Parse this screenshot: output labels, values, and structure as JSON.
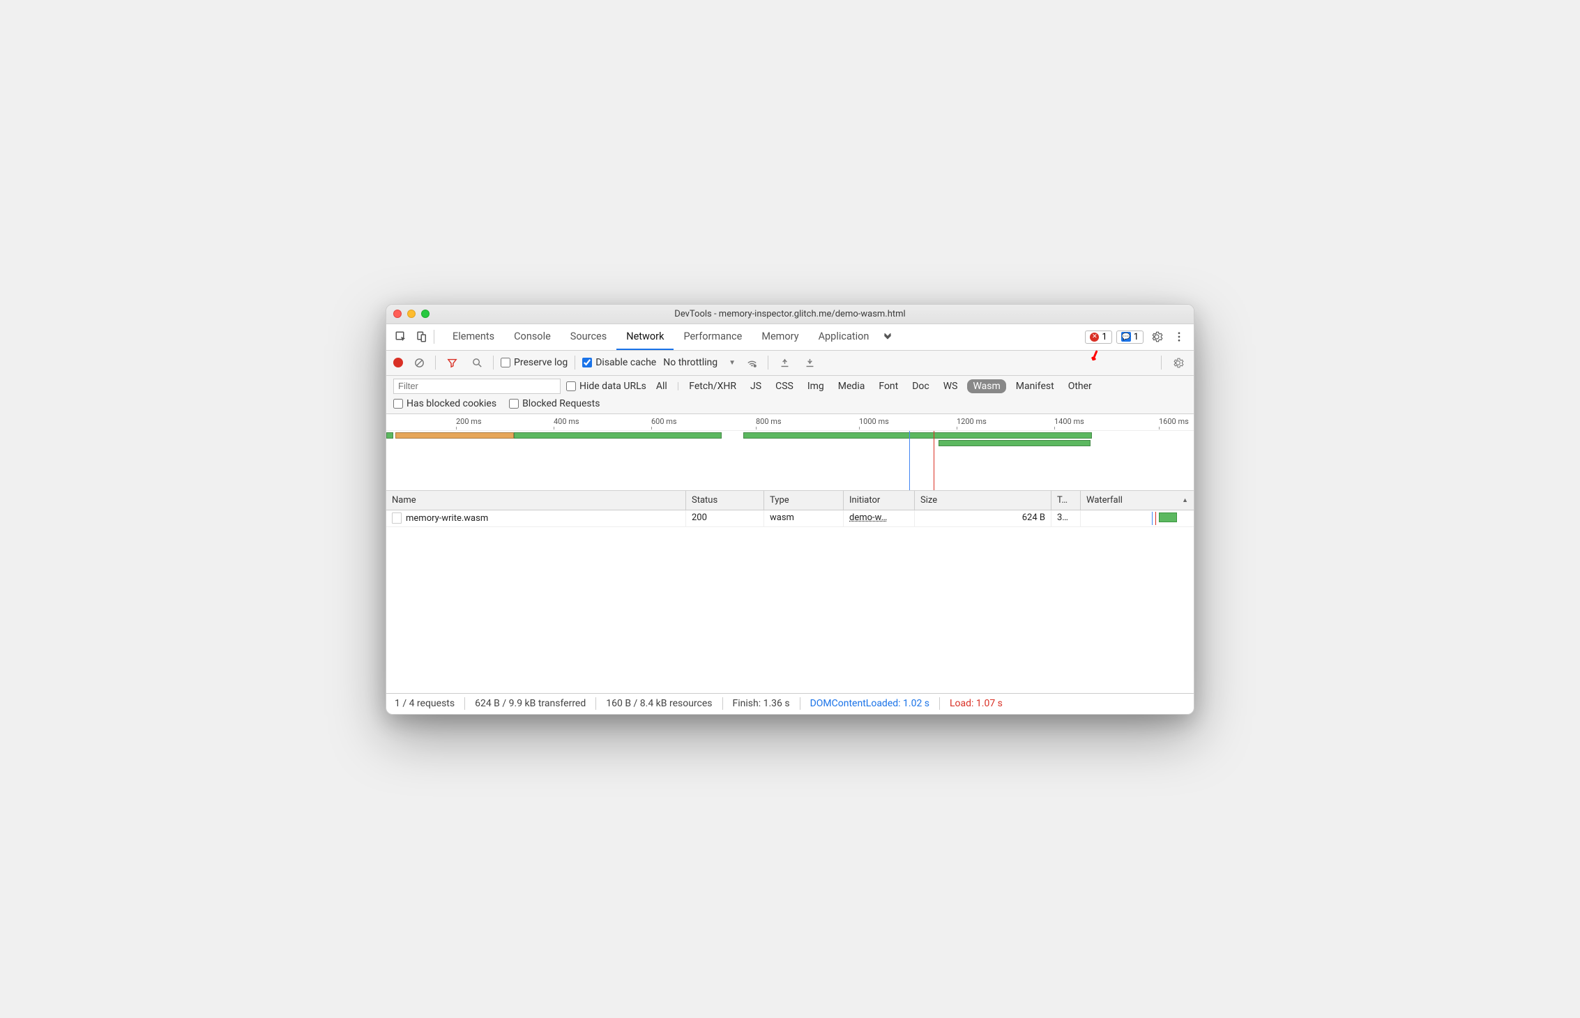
{
  "window": {
    "title": "DevTools - memory-inspector.glitch.me/demo-wasm.html"
  },
  "tabs": [
    "Elements",
    "Console",
    "Sources",
    "Network",
    "Performance",
    "Memory",
    "Application"
  ],
  "active_tab": "Network",
  "badges": {
    "err": "1",
    "msg": "1"
  },
  "toolbar": {
    "preserve": "Preserve log",
    "disable": "Disable cache",
    "throttle": "No throttling"
  },
  "filter": {
    "placeholder": "Filter",
    "hide_urls": "Hide data URLs",
    "types": [
      "All",
      "Fetch/XHR",
      "JS",
      "CSS",
      "Img",
      "Media",
      "Font",
      "Doc",
      "WS",
      "Wasm",
      "Manifest",
      "Other"
    ],
    "active_type": "Wasm",
    "blocked_cookies": "Has blocked cookies",
    "blocked_req": "Blocked Requests"
  },
  "timeline": {
    "ticks": [
      "200 ms",
      "400 ms",
      "600 ms",
      "800 ms",
      "1000 ms",
      "1200 ms",
      "1400 ms",
      "1600 ms"
    ]
  },
  "table": {
    "headers": {
      "name": "Name",
      "status": "Status",
      "type": "Type",
      "initiator": "Initiator",
      "size": "Size",
      "time": "T…",
      "waterfall": "Waterfall"
    },
    "row": {
      "name": "memory-write.wasm",
      "status": "200",
      "type": "wasm",
      "initiator": "demo-w…",
      "size": "624 B",
      "time": "3…"
    }
  },
  "status": {
    "requests": "1 / 4 requests",
    "transferred": "624 B / 9.9 kB transferred",
    "resources": "160 B / 8.4 kB resources",
    "finish": "Finish: 1.36 s",
    "dcl": "DOMContentLoaded: 1.02 s",
    "load": "Load: 1.07 s"
  }
}
